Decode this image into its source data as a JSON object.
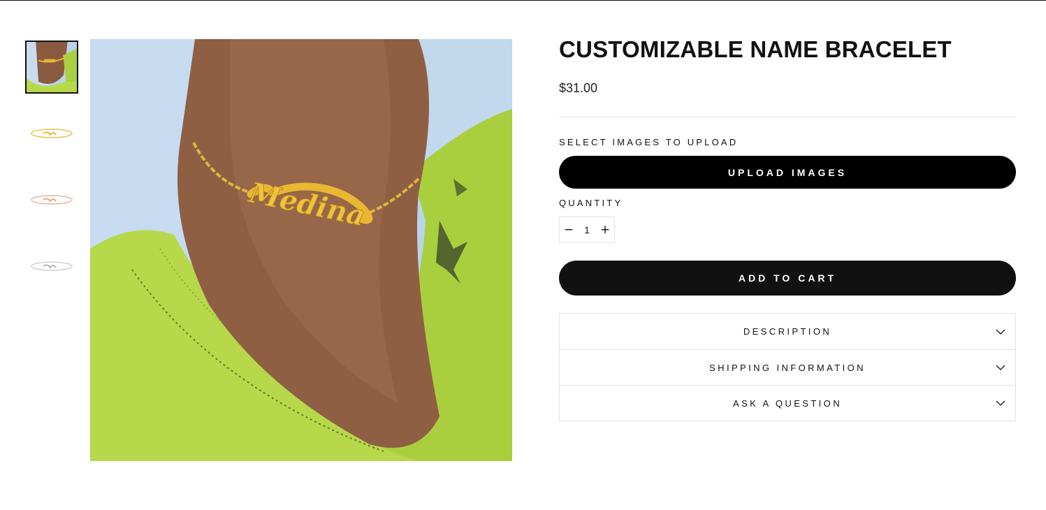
{
  "product": {
    "title": "CUSTOMIZABLE NAME BRACELET",
    "price": "$31.00",
    "bracelet_name": "Medina"
  },
  "gallery": {
    "thumbnails": [
      {
        "name": "thumbnail-gold-on-wrist",
        "active": true
      },
      {
        "name": "thumbnail-gold-bracelet"
      },
      {
        "name": "thumbnail-rose-gold-bracelet"
      },
      {
        "name": "thumbnail-silver-bracelet"
      }
    ]
  },
  "upload": {
    "label": "SELECT IMAGES TO UPLOAD",
    "button_label": "UPLOAD IMAGES"
  },
  "quantity": {
    "label": "QUANTITY",
    "value": "1",
    "minus": "−",
    "plus": "+"
  },
  "cart": {
    "button_label": "ADD TO CART"
  },
  "accordion": {
    "items": [
      {
        "label": "DESCRIPTION"
      },
      {
        "label": "SHIPPING INFORMATION"
      },
      {
        "label": "ASK A QUESTION"
      }
    ]
  },
  "colors": {
    "button_bg": "#000000",
    "text": "#111111",
    "border": "#e2e2e2",
    "gold": "#e9b832",
    "rose_gold": "#e4a38f",
    "silver": "#c9c9c9"
  },
  "icons": {
    "accordion": "chevron-down-icon",
    "qty_minus": "minus-icon",
    "qty_plus": "plus-icon"
  }
}
